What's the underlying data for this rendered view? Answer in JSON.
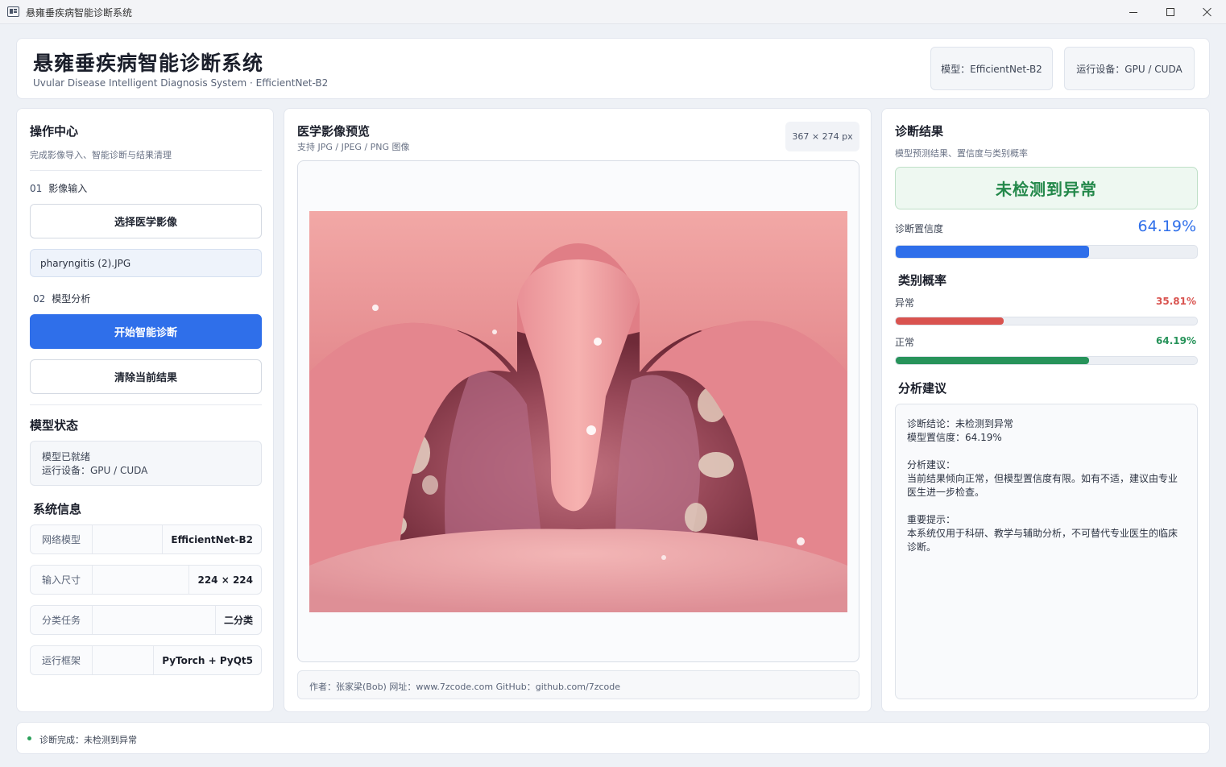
{
  "window": {
    "title": "悬雍垂疾病智能诊断系统"
  },
  "header": {
    "title": "悬雍垂疾病智能诊断系统",
    "subtitle": "Uvular Disease Intelligent Diagnosis System · EfficientNet-B2",
    "model_pill": "模型：EfficientNet-B2",
    "device_pill": "运行设备：GPU / CUDA"
  },
  "left": {
    "title": "操作中心",
    "subtitle": "完成影像导入、智能诊断与结果清理",
    "step1_num": "01",
    "step1_label": "影像输入",
    "select_button": "选择医学影像",
    "file_name": "pharyngitis (2).JPG",
    "step2_num": "02",
    "step2_label": "模型分析",
    "start_button": "开始智能诊断",
    "clear_button": "清除当前结果",
    "model_status_title": "模型状态",
    "model_status_line1": "模型已就绪",
    "model_status_line2": "运行设备：GPU / CUDA",
    "system_info_title": "系统信息",
    "info_rows": [
      {
        "key": "网络模型",
        "value": "EfficientNet-B2"
      },
      {
        "key": "输入尺寸",
        "value": "224 × 224"
      },
      {
        "key": "分类任务",
        "value": "二分类"
      },
      {
        "key": "运行框架",
        "value": "PyTorch + PyQt5"
      }
    ]
  },
  "center": {
    "title": "医学影像预览",
    "subtitle": "支持 JPG / JPEG / PNG 图像",
    "size_badge": "367 × 274 px",
    "footer": "作者：张家梁(Bob)  网址：www.7zcode.com GitHub：github.com/7zcode"
  },
  "right": {
    "title": "诊断结果",
    "subtitle": "模型预测结果、置信度与类别概率",
    "result": "未检测到异常",
    "confidence_label": "诊断置信度",
    "confidence_value": "64.19%",
    "confidence_fraction": 0.6419,
    "class_prob_title": "类别概率",
    "classes": [
      {
        "name": "异常",
        "value": "35.81%",
        "fraction": 0.3581,
        "color": "#d9534f"
      },
      {
        "name": "正常",
        "value": "64.19%",
        "fraction": 0.6419,
        "color": "#27935a"
      }
    ],
    "advice_title": "分析建议",
    "advice": {
      "conclusion": "诊断结论：未检测到异常",
      "confidence": "模型置信度：64.19%",
      "suggest_title": "分析建议：",
      "suggest_text": "当前结果倾向正常，但模型置信度有限。如有不适，建议由专业医生进一步检查。",
      "notice_title": "重要提示：",
      "notice_text": "本系统仅用于科研、教学与辅助分析，不可替代专业医生的临床诊断。"
    }
  },
  "statusbar": {
    "text": "诊断完成：未检测到异常"
  },
  "colors": {
    "primary": "#2f6fea",
    "success": "#27935a",
    "danger": "#d9534f"
  }
}
